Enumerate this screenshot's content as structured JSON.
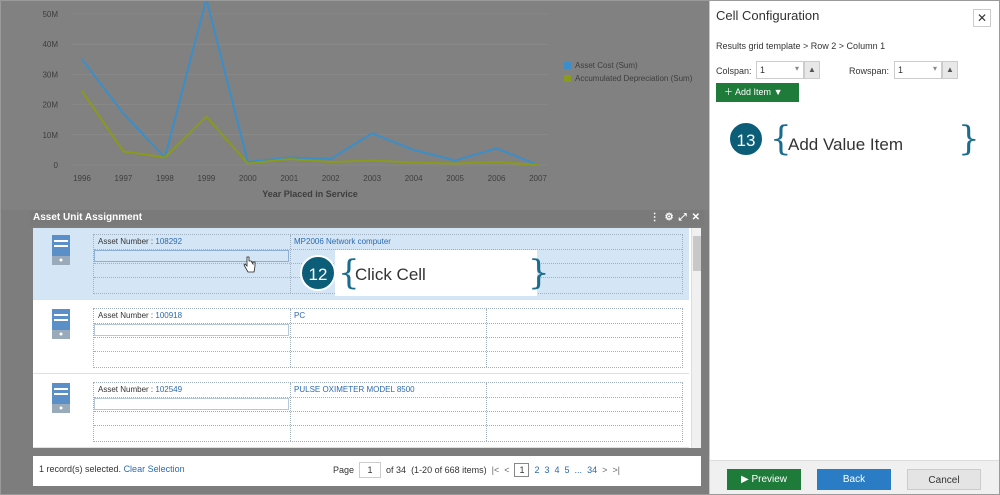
{
  "chart_data": {
    "type": "line",
    "x": [
      "1996",
      "1997",
      "1998",
      "1999",
      "2000",
      "2001",
      "2002",
      "2003",
      "2004",
      "2005",
      "2006",
      "2007"
    ],
    "series": [
      {
        "name": "Asset Cost (Sum)",
        "color": "#3b8ec8",
        "values": [
          35,
          17,
          2.5,
          55,
          1,
          2.5,
          2,
          10.5,
          5,
          1.5,
          5.5,
          0
        ]
      },
      {
        "name": "Accumulated Depreciation (Sum)",
        "color": "#8a9a1a",
        "values": [
          24.5,
          4.5,
          2.5,
          16,
          0.5,
          2,
          1,
          1.5,
          0.8,
          0.5,
          1,
          0
        ]
      }
    ],
    "yticks": [
      "0",
      "10M",
      "20M",
      "30M",
      "40M",
      "50M"
    ],
    "ylim": [
      0,
      52
    ],
    "xlabel": "Year Placed in Service",
    "legend_position": "right"
  },
  "panel": {
    "title": "Asset Unit Assignment"
  },
  "rows": [
    {
      "label": "Asset Number :",
      "number": "108292",
      "desc": "MP2006 Network computer"
    },
    {
      "label": "Asset Number :",
      "number": "100918",
      "desc": "PC"
    },
    {
      "label": "Asset Number :",
      "number": "102549",
      "desc": "PULSE OXIMETER MODEL 8500"
    }
  ],
  "footer": {
    "selected_text": "1 record(s) selected.",
    "clear_selection": "Clear Selection",
    "page_label": "Page",
    "page_value": "1",
    "of_pages": "of 34",
    "range": "(1-20 of 668 items)",
    "pages": [
      "1",
      "2",
      "3",
      "4",
      "5",
      "...",
      "34"
    ]
  },
  "callouts": {
    "step12_num": "12",
    "step12_text": "Click Cell",
    "step13_num": "13",
    "step13_text": "Add Value Item"
  },
  "dialog": {
    "title": "Cell Configuration",
    "breadcrumb": "Results grid template > Row 2 > Column 1",
    "colspan_label": "Colspan:",
    "colspan_value": "1",
    "rowspan_label": "Rowspan:",
    "rowspan_value": "1",
    "add_item_label": "Add Item",
    "preview_label": "Preview",
    "back_label": "Back",
    "cancel_label": "Cancel"
  },
  "icons": {
    "close": "close-icon",
    "plus": "plus-icon",
    "caret": "caret-down-icon",
    "play": "play-icon",
    "cursor": "hand-cursor-icon"
  }
}
